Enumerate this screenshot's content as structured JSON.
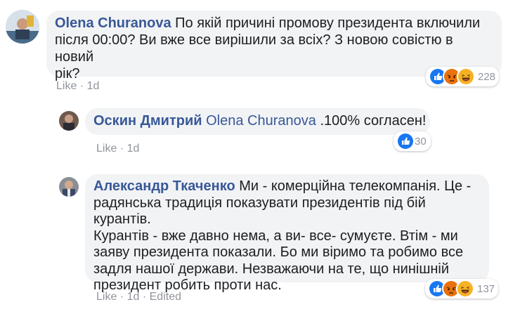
{
  "comments": [
    {
      "author": "Olena Churanova",
      "lines": [
        " По якій причині промову президента включили",
        "після 00:00? Ви вже все вирішили за всіх? З новою совістю в новий",
        "рік?"
      ],
      "meta": {
        "like": "Like",
        "time": "1d"
      },
      "reactions": {
        "icons": [
          "like-icon",
          "angry-icon",
          "haha-icon"
        ],
        "count": "228"
      }
    },
    {
      "author": "Оскин Дмитрий",
      "tag": "Olena Churanova",
      "text": " .100% согласен!",
      "meta": {
        "like": "Like",
        "time": "1d"
      },
      "reactions": {
        "icons": [
          "like-icon"
        ],
        "count": "30"
      }
    },
    {
      "author": "Александр Ткаченко",
      "lines": [
        " Ми - комерційна телекомпанія. Це -",
        "радянська традиція показувати президентів під бій курантів.",
        "Курантів - вже давно нема, а ви- все- сумуєте. Втім - ми",
        "заяву президента показали. Бо ми віримо та робимо все",
        "задля нашої держави. Незважаючи на те, що нинішній",
        "президент робить проти нас."
      ],
      "meta": {
        "like": "Like",
        "time": "1d",
        "edited": "Edited"
      },
      "reactions": {
        "icons": [
          "like-icon",
          "angry-icon",
          "haha-icon"
        ],
        "count": "137"
      }
    }
  ],
  "colors": {
    "author": "#385898",
    "bubble": "#f2f3f5",
    "meta": "#90949c",
    "like": "#1877f2",
    "angry": "#e9710f",
    "haha": "#f7b125"
  }
}
